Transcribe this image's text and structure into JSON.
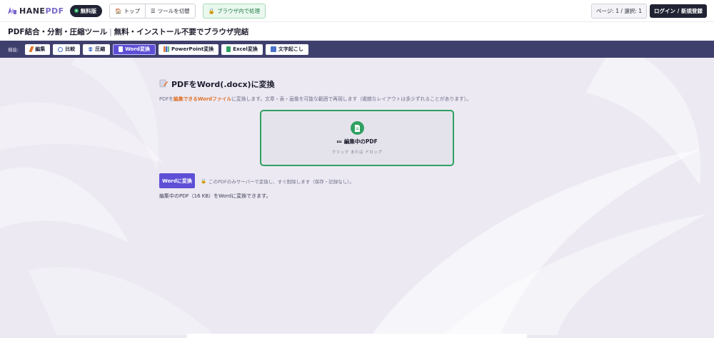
{
  "brand": {
    "logo_text_a": "HANE",
    "logo_text_b": "PDF",
    "free_label": "無料版"
  },
  "topbar": {
    "top_label": "トップ",
    "switch_tool_label": "ツールを切替",
    "local_label": "ブラウザ内で処理",
    "page_info": "ページ: 1 / 選択: 1",
    "login_label": "ログイン / 新規登録"
  },
  "title": {
    "main": "PDF結合・分割・圧縮ツール",
    "sep": "|",
    "sub": "無料・インストール不要でブラウザ完結"
  },
  "toolbar": {
    "label": "機能:",
    "items": [
      {
        "label": "編集",
        "icon": "pencil-icon",
        "color": "#e0722a",
        "active": false
      },
      {
        "label": "比較",
        "icon": "magnifier-icon",
        "color": "#4a72c8",
        "active": false
      },
      {
        "label": "圧縮",
        "icon": "compress-icon",
        "color": "#4a72c8",
        "active": false
      },
      {
        "label": "Word変換",
        "icon": "document-icon",
        "color": "#ffffff",
        "active": true
      },
      {
        "label": "PowerPoint変換",
        "icon": "chart-icon",
        "color": "#e0722a",
        "active": false
      },
      {
        "label": "Excel変換",
        "icon": "spreadsheet-icon",
        "color": "#2fa060",
        "active": false
      },
      {
        "label": "文字起こし",
        "icon": "text-icon",
        "color": "#4a72c8",
        "active": false
      }
    ]
  },
  "main": {
    "heading": "PDFをWord(.docx)に変換",
    "desc_pre": "PDFを",
    "desc_hl": "編集できるWordファイル",
    "desc_post": "に変換します。文章・表・画像を可能な範囲で再現します（複雑なレイアウトは多少ずれることがあります）。"
  },
  "dropzone": {
    "title": "≔ 編集中のPDF",
    "sub": "クリック または ドロップ"
  },
  "convert": {
    "button_label": "Wordに変換",
    "note": "このPDFのみサーバーで変換し、すぐ削除します（保存・記録なし）。",
    "status": "編集中のPDF（16 KB）をWordに変換できます。"
  },
  "colors": {
    "accent": "#5e4fd6",
    "nav": "#3f3f6e",
    "success": "#2fa060"
  }
}
